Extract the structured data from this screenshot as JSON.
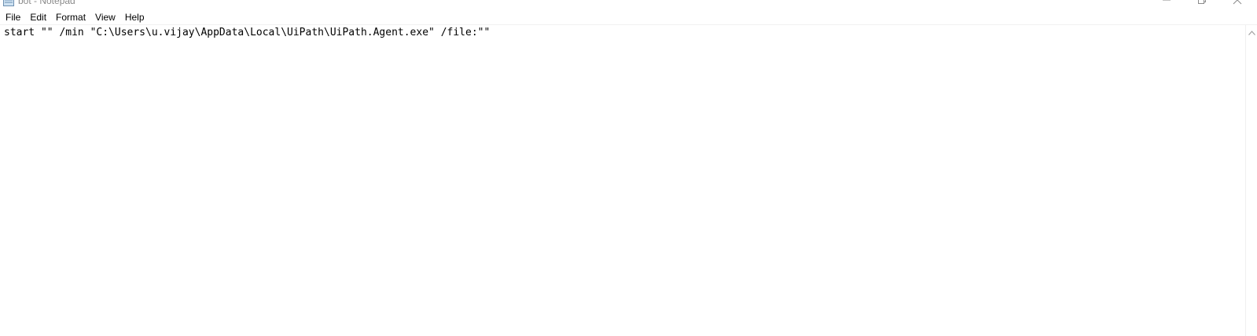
{
  "window": {
    "title": "bot - Notepad"
  },
  "icons": {
    "app": "notepad-icon",
    "minimize": "minimize-icon",
    "restore": "restore-icon",
    "close": "close-icon",
    "scroll_up": "chevron-up-icon"
  },
  "menu": {
    "items": [
      {
        "label": "File"
      },
      {
        "label": "Edit"
      },
      {
        "label": "Format"
      },
      {
        "label": "View"
      },
      {
        "label": "Help"
      }
    ]
  },
  "editor": {
    "content": "start \"\" /min \"C:\\Users\\u.vijay\\AppData\\Local\\UiPath\\UiPath.Agent.exe\" /file:\"\""
  },
  "colors": {
    "background": "#ffffff",
    "text": "#000000",
    "title_text": "#8a8a8a"
  }
}
